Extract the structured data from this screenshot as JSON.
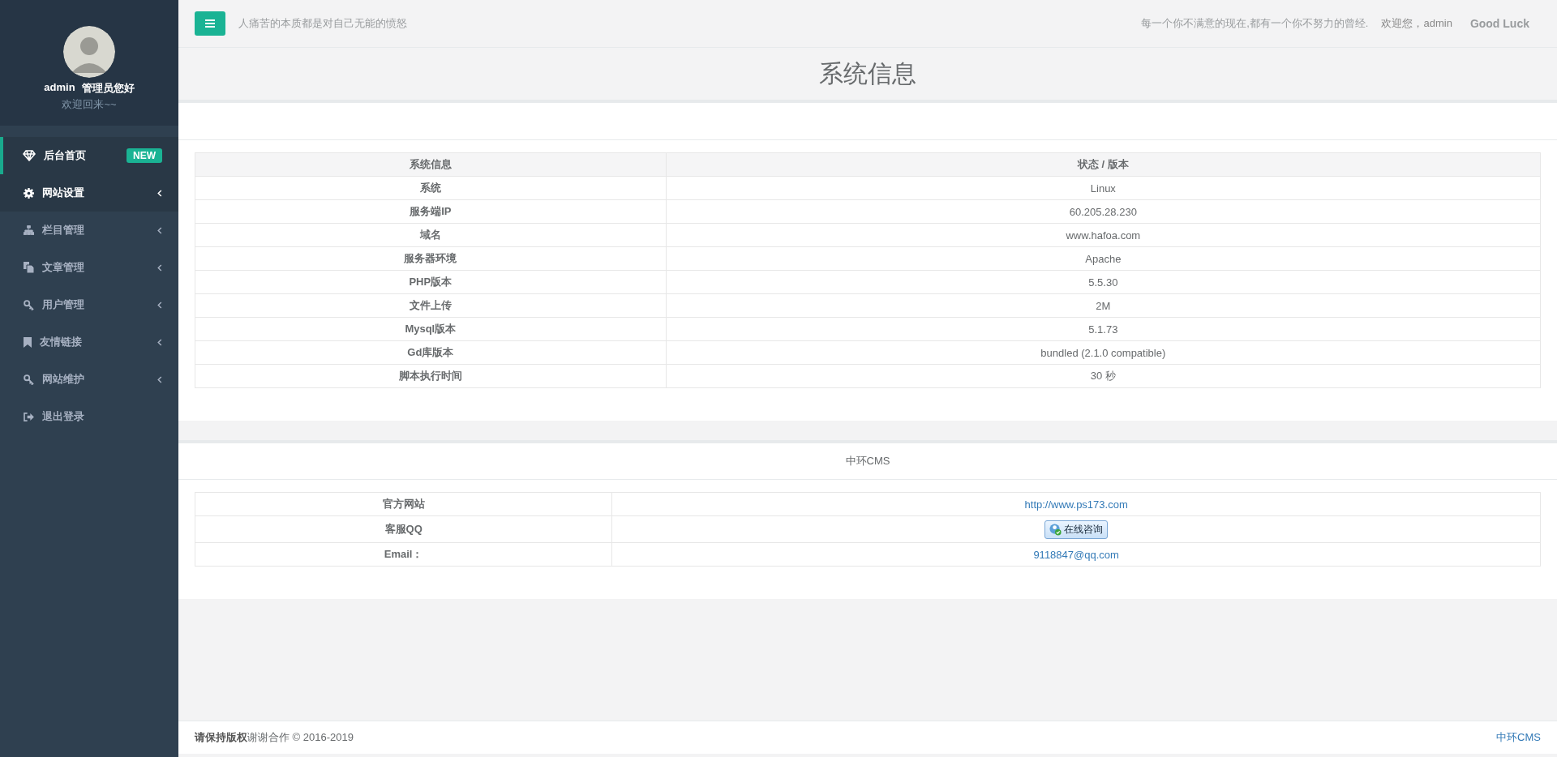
{
  "sidebar": {
    "profile": {
      "name": "admin",
      "role": "管理员您好",
      "greeting": "欢迎回来~~"
    },
    "items": [
      {
        "label": "后台首页",
        "selected": true,
        "expanded": false,
        "badge": "NEW",
        "has_submenu": false
      },
      {
        "label": "网站设置",
        "selected": false,
        "expanded": true,
        "has_submenu": true
      },
      {
        "label": "栏目管理",
        "selected": false,
        "expanded": false,
        "has_submenu": true
      },
      {
        "label": "文章管理",
        "selected": false,
        "expanded": false,
        "has_submenu": true
      },
      {
        "label": "用户管理",
        "selected": false,
        "expanded": false,
        "has_submenu": true
      },
      {
        "label": "友情链接",
        "selected": false,
        "expanded": false,
        "has_submenu": true
      },
      {
        "label": "网站维护",
        "selected": false,
        "expanded": false,
        "has_submenu": true
      },
      {
        "label": "退出登录",
        "selected": false,
        "expanded": false,
        "has_submenu": false
      }
    ]
  },
  "topbar": {
    "motto": "人痛苦的本质都是对自己无能的愤怒",
    "quote": "每一个你不满意的现在,都有一个你不努力的曾经.",
    "welcome": "欢迎您，admin",
    "luck": "Good Luck"
  },
  "page_title": "系统信息",
  "system_table": {
    "columns": [
      "系统信息",
      "状态 / 版本"
    ],
    "rows": [
      [
        "系统",
        "Linux"
      ],
      [
        "服务端IP",
        "60.205.28.230"
      ],
      [
        "域名",
        "www.hafoa.com"
      ],
      [
        "服务器环境",
        "Apache"
      ],
      [
        "PHP版本",
        "5.5.30"
      ],
      [
        "文件上传",
        "2M"
      ],
      [
        "Mysql版本",
        "5.1.73"
      ],
      [
        "Gd库版本",
        "bundled (2.1.0 compatible)"
      ],
      [
        "脚本执行时间",
        "30 秒"
      ]
    ]
  },
  "cms_panel": {
    "title": "中环CMS",
    "rows": [
      {
        "label": "官方网站",
        "kind": "link",
        "value": "http://www.ps173.com"
      },
      {
        "label": "客服QQ",
        "kind": "button",
        "value": "在线咨询"
      },
      {
        "label": "Email：",
        "kind": "link",
        "value": "9118847@qq.com"
      }
    ]
  },
  "footer": {
    "copyright": "**请保持版权**谢谢合作 © 2016-2019",
    "brand": "中环CMS"
  }
}
